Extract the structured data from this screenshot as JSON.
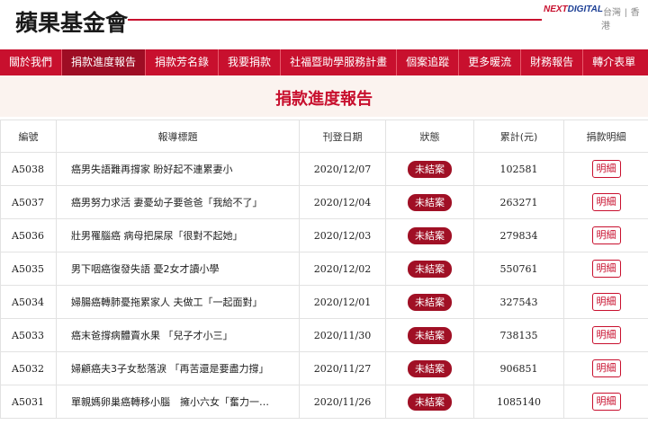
{
  "header": {
    "logo_text": "蘋果基金會",
    "brand_prefix": "NEXT",
    "brand_suffix": "DIGITAL",
    "region_tw": "台灣",
    "region_sep": "|",
    "region_hk": "香港",
    "accent_color": "#c8102e"
  },
  "nav": {
    "items": [
      {
        "label": "關於我們",
        "active": false
      },
      {
        "label": "捐款進度報告",
        "active": true
      },
      {
        "label": "捐款芳名錄",
        "active": false
      },
      {
        "label": "我要捐款",
        "active": false
      },
      {
        "label": "社福暨助學服務計畫",
        "active": false
      },
      {
        "label": "個案追蹤",
        "active": false
      },
      {
        "label": "更多暖流",
        "active": false
      },
      {
        "label": "財務報告",
        "active": false
      },
      {
        "label": "轉介表單",
        "active": false
      }
    ]
  },
  "page": {
    "title": "捐款進度報告"
  },
  "table": {
    "columns": [
      "編號",
      "報導標題",
      "刊登日期",
      "狀態",
      "累計(元)",
      "捐款明細"
    ],
    "rows": [
      {
        "id": "A5038",
        "headline": "癌男失語難再撐家 盼好起不連累妻小",
        "date": "2020/12/07",
        "status": "未結案",
        "amount": "102581",
        "detail": "明細"
      },
      {
        "id": "A5037",
        "headline": "癌男努力求活 妻憂幼子要爸爸「我給不了」",
        "date": "2020/12/04",
        "status": "未結案",
        "amount": "263271",
        "detail": "明細"
      },
      {
        "id": "A5036",
        "headline": "壯男罹腦癌 病母把屎尿「很對不起她」",
        "date": "2020/12/03",
        "status": "未結案",
        "amount": "279834",
        "detail": "明細"
      },
      {
        "id": "A5035",
        "headline": "男下咽癌復發失語 憂2女才讀小學",
        "date": "2020/12/02",
        "status": "未結案",
        "amount": "550761",
        "detail": "明細"
      },
      {
        "id": "A5034",
        "headline": "婦腸癌轉肺憂拖累家人 夫做工「一起面對」",
        "date": "2020/12/01",
        "status": "未結案",
        "amount": "327543",
        "detail": "明細"
      },
      {
        "id": "A5033",
        "headline": "癌末爸撐病體賣水果 「兒子才小三」",
        "date": "2020/11/30",
        "status": "未結案",
        "amount": "738135",
        "detail": "明細"
      },
      {
        "id": "A5032",
        "headline": "婦顧癌夫3子女愁落淚 「再苦還是要盡力撐」",
        "date": "2020/11/27",
        "status": "未結案",
        "amount": "906851",
        "detail": "明細"
      },
      {
        "id": "A5031",
        "headline": "單親媽卵巢癌轉移小腦　擁小六女「奮力一…",
        "date": "2020/11/26",
        "status": "未結案",
        "amount": "1085140",
        "detail": "明細"
      }
    ]
  }
}
